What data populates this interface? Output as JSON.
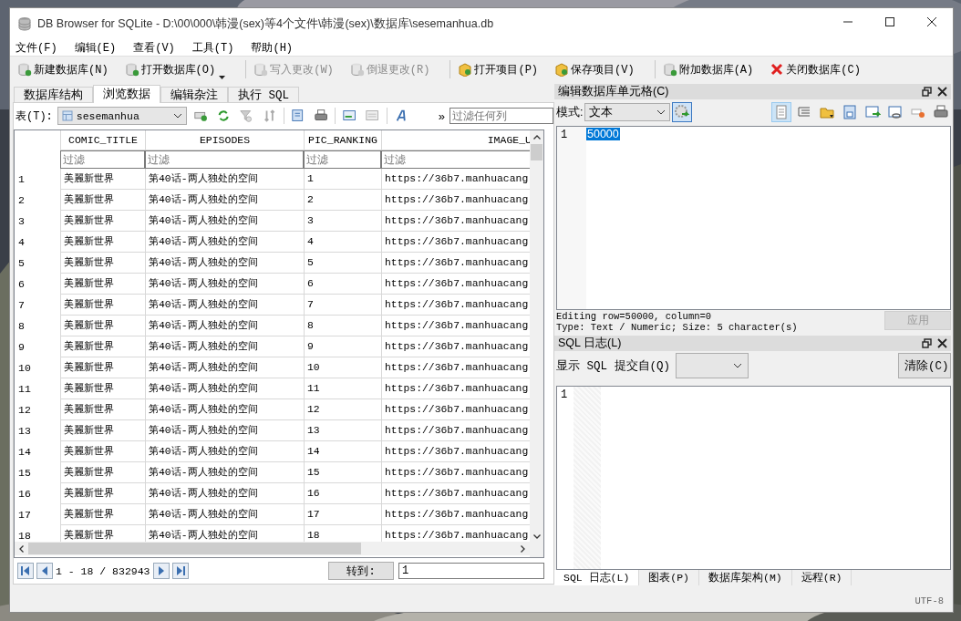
{
  "window": {
    "title": "DB Browser for SQLite - D:\\00\\000\\韩漫(sex)等4个文件\\韩漫(sex)\\数据库\\sesemanhua.db"
  },
  "menu": [
    "文件(F)",
    "编辑(E)",
    "查看(V)",
    "工具(T)",
    "帮助(H)"
  ],
  "toolbar": [
    {
      "kind": "new-db",
      "label": "新建数据库(N)",
      "disabled": false
    },
    {
      "kind": "open-db",
      "label": "打开数据库(O)",
      "disabled": false,
      "dropdown": true
    },
    {
      "kind": "write",
      "label": "写入更改(W)",
      "disabled": true
    },
    {
      "kind": "revert",
      "label": "倒退更改(R)",
      "disabled": true
    },
    {
      "kind": "open-project",
      "label": "打开项目(P)",
      "disabled": false
    },
    {
      "kind": "save-project",
      "label": "保存项目(V)",
      "disabled": false
    },
    {
      "kind": "attach",
      "label": "附加数据库(A)",
      "disabled": false
    },
    {
      "kind": "close",
      "label": "关闭数据库(C)",
      "disabled": false
    }
  ],
  "tabs": [
    {
      "label": "数据库结构",
      "selected": false
    },
    {
      "label": "浏览数据",
      "selected": true
    },
    {
      "label": "编辑杂注",
      "selected": false
    },
    {
      "label": "执行 SQL",
      "selected": false
    }
  ],
  "table_bar": {
    "label": "表(T):",
    "table": "sesemanhua",
    "more": "»",
    "filter_placeholder": "过滤任何列"
  },
  "grid": {
    "columns": [
      {
        "label": "COMIC_TITLE",
        "placeholder": "过滤"
      },
      {
        "label": "EPISODES",
        "placeholder": "过滤"
      },
      {
        "label": "PIC_RANKING",
        "placeholder": "过滤"
      },
      {
        "label": "IMAGE_U",
        "placeholder": "过滤"
      }
    ],
    "rows": [
      {
        "num": "1",
        "cells": [
          "美麗新世界",
          "第40话-两人独处的空间",
          "1",
          "https://36b7.manhuacang"
        ]
      },
      {
        "num": "2",
        "cells": [
          "美麗新世界",
          "第40话-两人独处的空间",
          "2",
          "https://36b7.manhuacang"
        ]
      },
      {
        "num": "3",
        "cells": [
          "美麗新世界",
          "第40话-两人独处的空间",
          "3",
          "https://36b7.manhuacang"
        ]
      },
      {
        "num": "4",
        "cells": [
          "美麗新世界",
          "第40话-两人独处的空间",
          "4",
          "https://36b7.manhuacang"
        ]
      },
      {
        "num": "5",
        "cells": [
          "美麗新世界",
          "第40话-两人独处的空间",
          "5",
          "https://36b7.manhuacang"
        ]
      },
      {
        "num": "6",
        "cells": [
          "美麗新世界",
          "第40话-两人独处的空间",
          "6",
          "https://36b7.manhuacang"
        ]
      },
      {
        "num": "7",
        "cells": [
          "美麗新世界",
          "第40话-两人独处的空间",
          "7",
          "https://36b7.manhuacang"
        ]
      },
      {
        "num": "8",
        "cells": [
          "美麗新世界",
          "第40话-两人独处的空间",
          "8",
          "https://36b7.manhuacang"
        ]
      },
      {
        "num": "9",
        "cells": [
          "美麗新世界",
          "第40话-两人独处的空间",
          "9",
          "https://36b7.manhuacang"
        ]
      },
      {
        "num": "10",
        "cells": [
          "美麗新世界",
          "第40话-两人独处的空间",
          "10",
          "https://36b7.manhuacang"
        ]
      },
      {
        "num": "11",
        "cells": [
          "美麗新世界",
          "第40话-两人独处的空间",
          "11",
          "https://36b7.manhuacang"
        ]
      },
      {
        "num": "12",
        "cells": [
          "美麗新世界",
          "第40话-两人独处的空间",
          "12",
          "https://36b7.manhuacang"
        ]
      },
      {
        "num": "13",
        "cells": [
          "美麗新世界",
          "第40话-两人独处的空间",
          "13",
          "https://36b7.manhuacang"
        ]
      },
      {
        "num": "14",
        "cells": [
          "美麗新世界",
          "第40话-两人独处的空间",
          "14",
          "https://36b7.manhuacang"
        ]
      },
      {
        "num": "15",
        "cells": [
          "美麗新世界",
          "第40话-两人独处的空间",
          "15",
          "https://36b7.manhuacang"
        ]
      },
      {
        "num": "16",
        "cells": [
          "美麗新世界",
          "第40话-两人独处的空间",
          "16",
          "https://36b7.manhuacang"
        ]
      },
      {
        "num": "17",
        "cells": [
          "美麗新世界",
          "第40话-两人独处的空间",
          "17",
          "https://36b7.manhuacang"
        ]
      },
      {
        "num": "18",
        "cells": [
          "美麗新世界",
          "第40话-两人独处的空间",
          "18",
          "https://36b7.manhuacang"
        ]
      }
    ]
  },
  "pager": {
    "range": "1 - 18 / 832943",
    "goto_label": "转到:",
    "goto_value": "1"
  },
  "edit_cell": {
    "title": "编辑数据库单元格(C)",
    "mode_label": "模式:",
    "mode": "文本",
    "tools": [
      {
        "kind": "text",
        "selected": true
      },
      {
        "kind": "wrap",
        "selected": false
      },
      {
        "kind": "import",
        "selected": false
      },
      {
        "kind": "export",
        "selected": false
      },
      {
        "kind": "set",
        "selected": false
      },
      {
        "kind": "link",
        "selected": false
      },
      {
        "kind": "null",
        "selected": false
      },
      {
        "kind": "print",
        "selected": false
      }
    ],
    "line": "1",
    "value": "50000",
    "info": [
      "Editing row=50000, column=0",
      "Type: Text / Numeric; Size: 5 character(s)"
    ],
    "apply": "应用",
    "apply_disabled": true
  },
  "sql_log": {
    "title": "SQL 日志(L)",
    "show_label": "显示 SQL 提交自(Q)",
    "clear": "清除(C)",
    "line": "1"
  },
  "bottom_tabs": [
    {
      "label": "SQL 日志(L)",
      "selected": true
    },
    {
      "label": "图表(P)",
      "selected": false
    },
    {
      "label": "数据库架构(M)",
      "selected": false
    },
    {
      "label": "远程(R)",
      "selected": false
    }
  ],
  "status_bar": {
    "encoding": "UTF-8"
  }
}
